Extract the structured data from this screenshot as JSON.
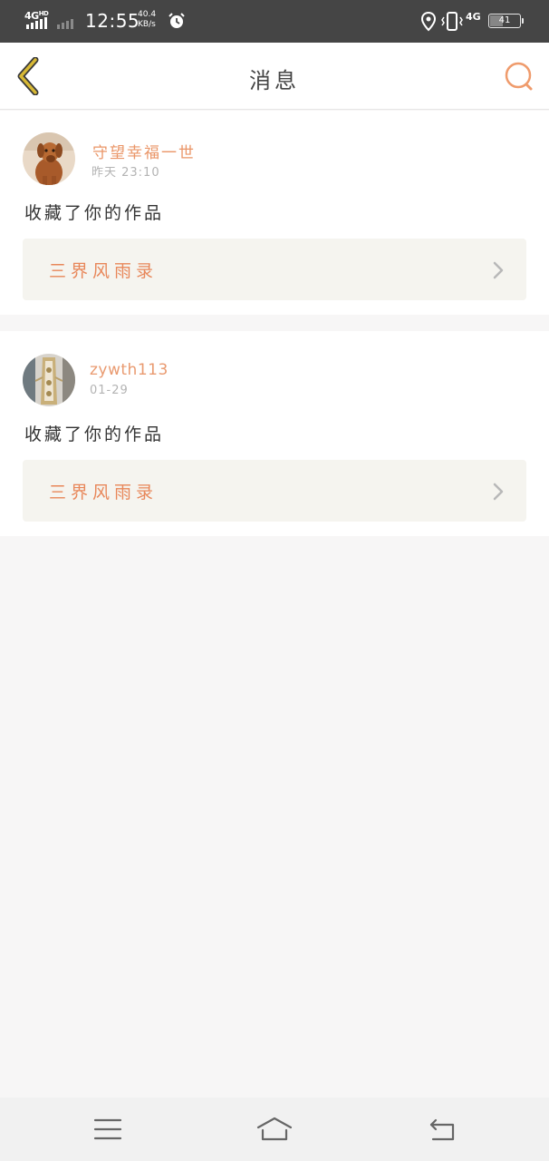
{
  "status_bar": {
    "network_left": "4G",
    "network_left_sup": "HD",
    "time": "12:55",
    "speed_value": "40.4",
    "speed_unit": "KB/s",
    "network_right": "4G",
    "battery": "41"
  },
  "header": {
    "title": "消息"
  },
  "messages": [
    {
      "username": "守望幸福一世",
      "time": "昨天 23:10",
      "action": "收藏了你的作品",
      "work_title": "三界风雨录"
    },
    {
      "username": "zywth113",
      "time": "01-29",
      "action": "收藏了你的作品",
      "work_title": "三界风雨录"
    }
  ],
  "colors": {
    "accent": "#e8875a",
    "back_icon": "#c9a82a",
    "status_bar": "#454545",
    "background": "#f7f6f6"
  },
  "icons": {
    "back": "chevron-left-icon",
    "search": "search-icon",
    "link": "chevron-right-icon",
    "nav_menu": "menu-icon",
    "nav_home": "home-icon",
    "nav_back": "back-icon"
  }
}
